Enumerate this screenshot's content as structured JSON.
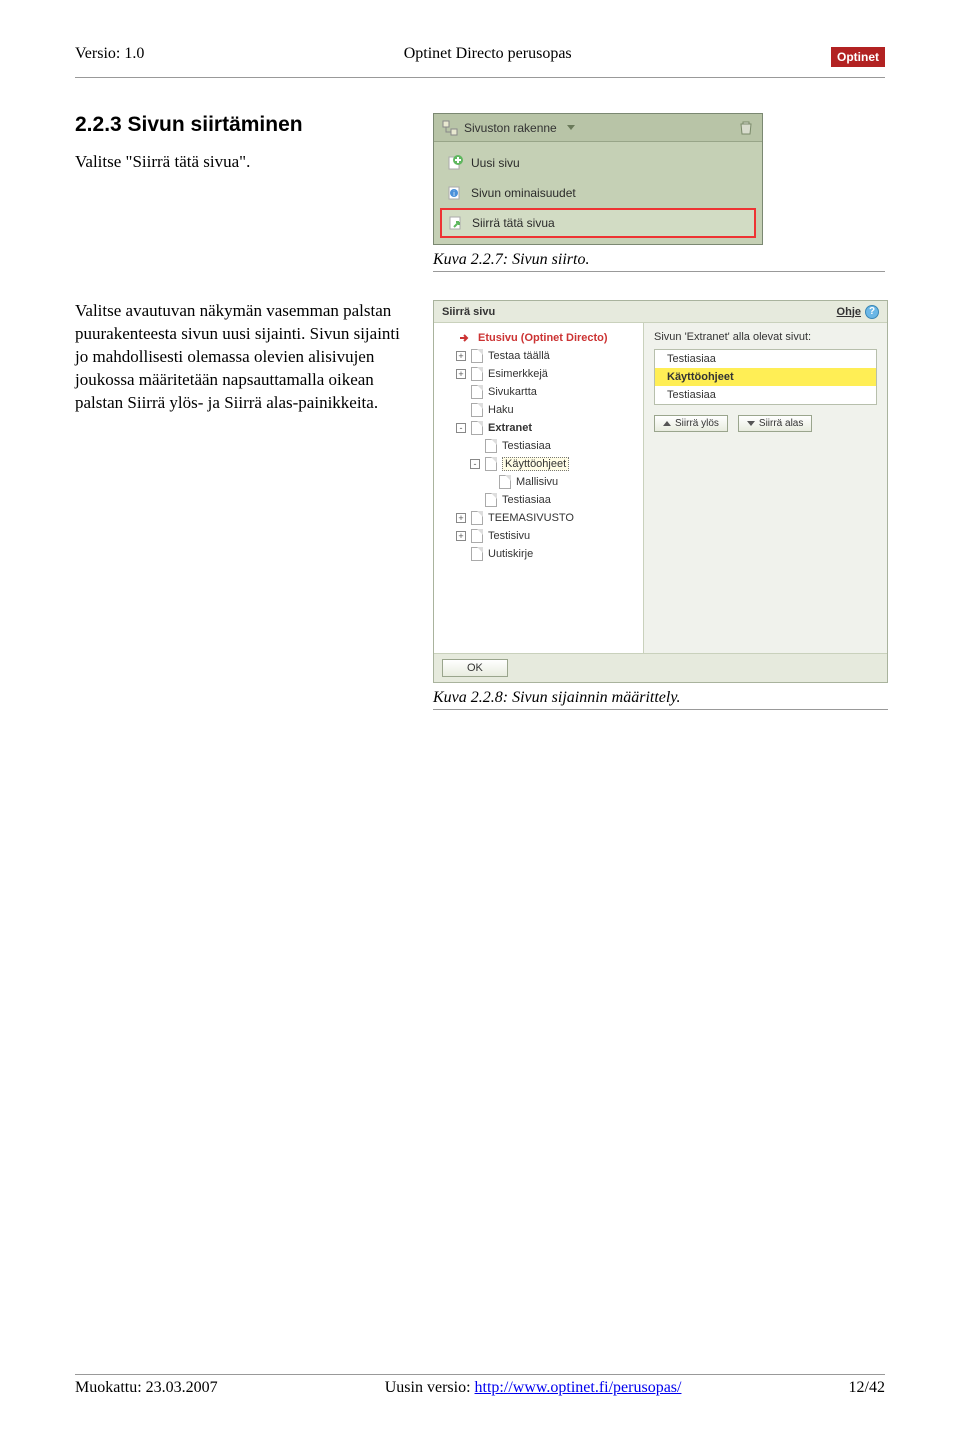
{
  "header": {
    "version": "Versio: 1.0",
    "title": "Optinet Directo perusopas",
    "logo": "Optinet"
  },
  "section": {
    "heading": "2.2.3   Sivun siirtäminen",
    "intro": "Valitse \"Siirrä tätä sivua\"."
  },
  "menu": {
    "title": "Sivuston rakenne",
    "items": [
      "Uusi sivu",
      "Sivun ominaisuudet",
      "Siirrä tätä sivua"
    ]
  },
  "caption1": "Kuva 2.2.7: Sivun siirto.",
  "para2": "Valitse avautuvan näkymän vasemman palstan puurakenteesta sivun uusi sijainti. Sivun sijainti jo mahdollisesti olemassa olevien alisivujen joukossa määritetään napsauttamalla oikean palstan Siirrä ylös- ja Siirrä alas-painikkeita.",
  "dialog": {
    "title": "Siirrä sivu",
    "help": "Ohje",
    "tree": [
      {
        "lv": 0,
        "home": true,
        "exp": "",
        "label": "Etusivu (Optinet Directo)"
      },
      {
        "lv": 1,
        "exp": "+",
        "label": "Testaa täällä"
      },
      {
        "lv": 1,
        "exp": "+",
        "label": "Esimerkkejä"
      },
      {
        "lv": 1,
        "exp": "",
        "label": "Sivukartta"
      },
      {
        "lv": 1,
        "exp": "",
        "label": "Haku"
      },
      {
        "lv": 1,
        "exp": "-",
        "bold": true,
        "label": "Extranet"
      },
      {
        "lv": 2,
        "exp": "",
        "label": "Testiasiaa"
      },
      {
        "lv": 2,
        "exp": "-",
        "sel": true,
        "label": "Käyttöohjeet"
      },
      {
        "lv": 3,
        "exp": "",
        "label": "Mallisivu"
      },
      {
        "lv": 2,
        "exp": "",
        "label": "Testiasiaa"
      },
      {
        "lv": 1,
        "exp": "+",
        "label": "TEEMASIVUSTO"
      },
      {
        "lv": 1,
        "exp": "+",
        "label": "Testisivu"
      },
      {
        "lv": 1,
        "exp": "",
        "label": "Uutiskirje"
      }
    ],
    "rightHead": "Sivun 'Extranet' alla olevat sivut:",
    "list": [
      {
        "label": "Testiasiaa",
        "hl": false
      },
      {
        "label": "Käyttöohjeet",
        "hl": true
      },
      {
        "label": "Testiasiaa",
        "hl": false
      }
    ],
    "btnUp": "Siirrä ylös",
    "btnDown": "Siirrä alas",
    "ok": "OK"
  },
  "caption2": "Kuva 2.2.8: Sivun sijainnin määrittely.",
  "footer": {
    "modified": "Muokattu: 23.03.2007",
    "latestLabel": "Uusin versio: ",
    "latestUrl": "http://www.optinet.fi/perusopas/",
    "page": "12/42"
  }
}
